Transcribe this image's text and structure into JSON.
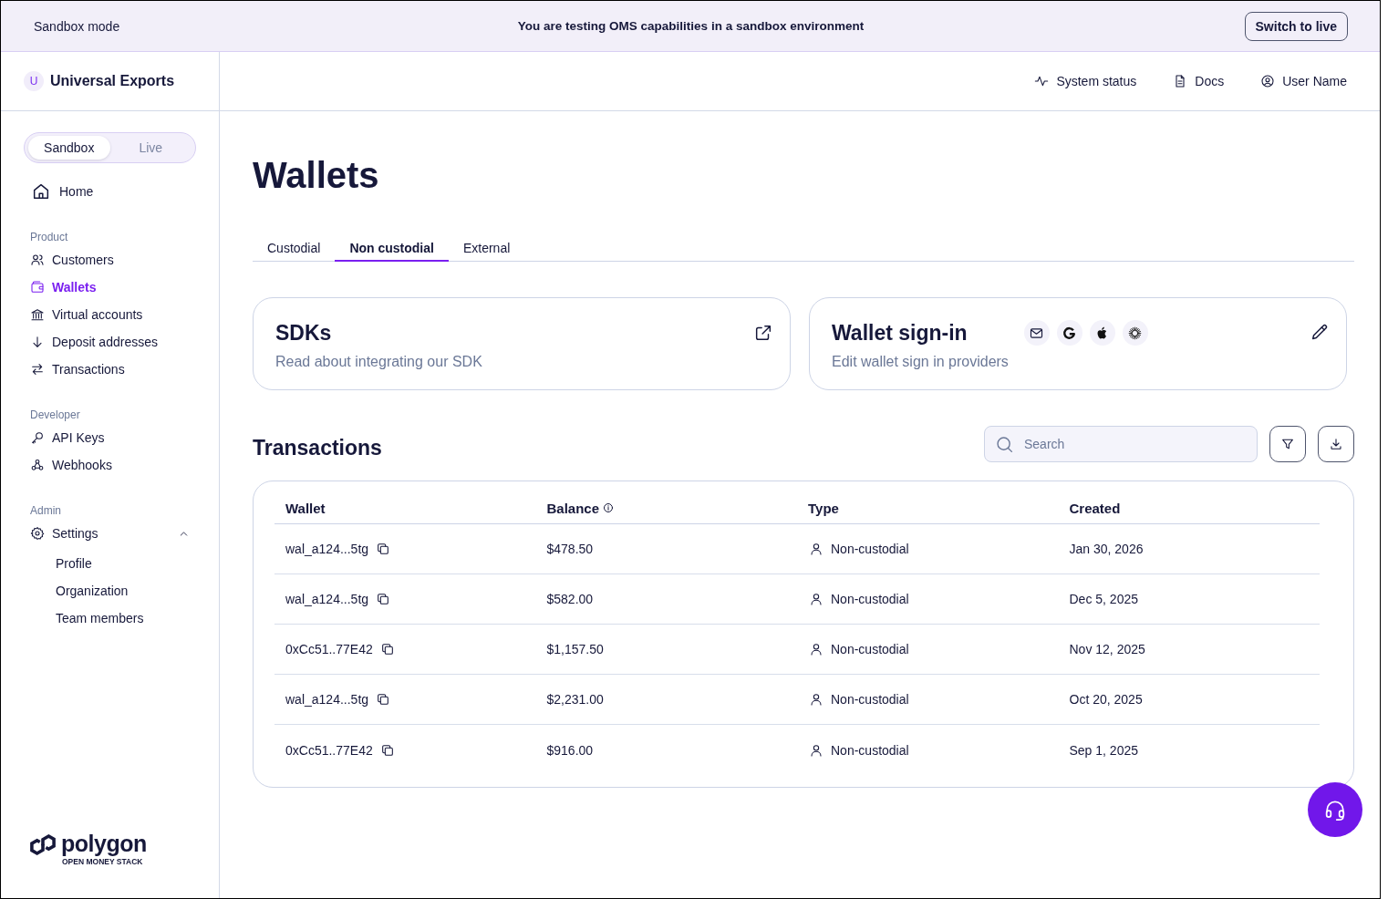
{
  "banner": {
    "label": "Sandbox mode",
    "message": "You are testing OMS capabilities in a sandbox environment",
    "button": "Switch to live"
  },
  "sidebar": {
    "org": {
      "initial": "U",
      "name": "Universal Exports"
    },
    "mode_toggle": [
      {
        "label": "Sandbox",
        "selected": true
      },
      {
        "label": "Live",
        "selected": false
      }
    ],
    "home": {
      "label": "Home",
      "selected": false
    },
    "sections": [
      {
        "title": "Product",
        "items": [
          {
            "label": "Customers",
            "selected": false
          },
          {
            "label": "Wallets",
            "selected": true
          },
          {
            "label": "Virtual accounts",
            "selected": false
          },
          {
            "label": "Deposit addresses",
            "selected": false
          },
          {
            "label": "Transactions",
            "selected": false
          }
        ]
      },
      {
        "title": "Developer",
        "items": [
          {
            "label": "API Keys",
            "selected": false
          },
          {
            "label": "Webhooks",
            "selected": false
          }
        ]
      },
      {
        "title": "Admin",
        "items": [
          {
            "label": "Settings",
            "selected": false,
            "expanded": true,
            "children": [
              {
                "label": "Profile",
                "selected": false
              },
              {
                "label": "Organization",
                "selected": false
              },
              {
                "label": "Team members",
                "selected": false
              }
            ]
          }
        ]
      }
    ],
    "brand": {
      "name": "polygon",
      "tagline": "OPEN MONEY STACK"
    }
  },
  "topbar": {
    "links": [
      "System status",
      "Docs",
      "User Name"
    ]
  },
  "page": {
    "title": "Wallets",
    "tabs": [
      {
        "label": "Custodial",
        "selected": false
      },
      {
        "label": "Non custodial",
        "selected": true
      },
      {
        "label": "External",
        "selected": false
      }
    ],
    "cards": [
      {
        "kind": "link",
        "title": "SDKs",
        "subtitle": "Read about integrating our SDK"
      },
      {
        "kind": "providers",
        "title": "Wallet sign-in",
        "subtitle": "Edit wallet sign in providers"
      }
    ]
  },
  "transactions": {
    "title": "Transactions",
    "search": {
      "placeholder": "Search"
    },
    "columns": [
      {
        "label": "Wallet",
        "info": false
      },
      {
        "label": "Balance",
        "info": true
      },
      {
        "label": "Type",
        "info": false
      },
      {
        "label": "Created",
        "info": false
      }
    ],
    "rows": [
      {
        "wallet": "wal_a124...5tg",
        "balance": "$478.50",
        "type": "Non-custodial",
        "created": "Jan 30, 2026"
      },
      {
        "wallet": "wal_a124...5tg",
        "balance": "$582.00",
        "type": "Non-custodial",
        "created": "Dec 5, 2025"
      },
      {
        "wallet": "0xCc51..77E42",
        "balance": "$1,157.50",
        "type": "Non-custodial",
        "created": "Nov 12, 2025"
      },
      {
        "wallet": "wal_a124...5tg",
        "balance": "$2,231.00",
        "type": "Non-custodial",
        "created": "Oct 20, 2025"
      },
      {
        "wallet": "0xCc51..77E42",
        "balance": "$916.00",
        "type": "Non-custodial",
        "created": "Sep 1, 2025"
      }
    ]
  }
}
